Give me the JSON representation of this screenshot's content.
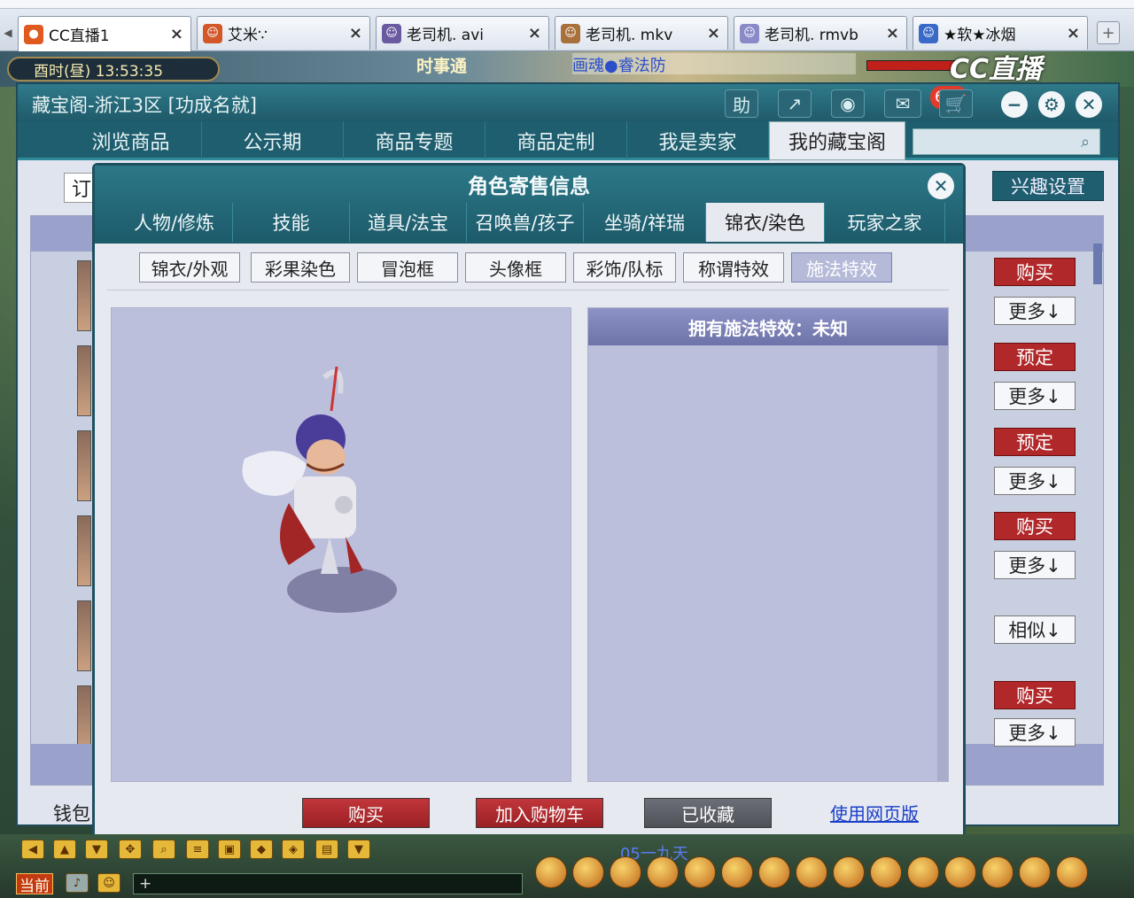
{
  "browser": {
    "tabs": [
      {
        "title": "CC直播1",
        "active": true
      },
      {
        "title": "艾米∵",
        "active": false
      },
      {
        "title": "老司机. avi",
        "active": false
      },
      {
        "title": "老司机. mkv",
        "active": false
      },
      {
        "title": "老司机. rmvb",
        "active": false
      },
      {
        "title": "★软★冰烟",
        "active": false
      }
    ],
    "close_glyph": "×",
    "new_tab_glyph": "+"
  },
  "game": {
    "time_label": "酉时(昼) 13:53:35",
    "banner": "时事通",
    "marquee": "画魂●睿法防",
    "cc_logo": "CC直播",
    "bottom_channel": "当前",
    "bottom_chat_plus": "+",
    "system_line": "05一九天"
  },
  "cbg": {
    "title": "藏宝阁-浙江3区 [功成名就]",
    "help_label": "助",
    "message_count": "682",
    "nav": [
      "浏览商品",
      "公示期",
      "商品专题",
      "商品定制",
      "我是卖家",
      "我的藏宝阁"
    ],
    "nav_active_index": 5,
    "sub_left": "订",
    "interest_button": "兴趣设置",
    "wallet_label": "钱包",
    "row_actions": [
      {
        "primary": "购买",
        "secondary": "更多↓"
      },
      {
        "primary": "预定",
        "secondary": "更多↓"
      },
      {
        "primary": "预定",
        "secondary": "更多↓"
      },
      {
        "primary": "购买",
        "secondary": "更多↓"
      },
      {
        "primary": "",
        "secondary": "相似↓"
      },
      {
        "primary": "购买",
        "secondary": "更多↓"
      }
    ]
  },
  "modal": {
    "title": "角色寄售信息",
    "tabs": [
      "人物/修炼",
      "技能",
      "道具/法宝",
      "召唤兽/孩子",
      "坐骑/祥瑞",
      "锦衣/染色",
      "玩家之家"
    ],
    "tab_active_index": 5,
    "subtabs": [
      "锦衣/外观",
      "彩果染色",
      "冒泡框",
      "头像框",
      "彩饰/队标",
      "称谓特效",
      "施法特效"
    ],
    "subtab_active_index": 6,
    "info_header": "拥有施法特效：未知",
    "buttons": {
      "buy": "购买",
      "add_to_cart": "加入购物车",
      "favorited": "已收藏",
      "web_version": "使用网页版"
    }
  },
  "colors": {
    "teal_header": "#1f5e6e",
    "red_button": "#b0282a",
    "preview_bg": "#bcbfdc",
    "link": "#1a3fc8"
  }
}
